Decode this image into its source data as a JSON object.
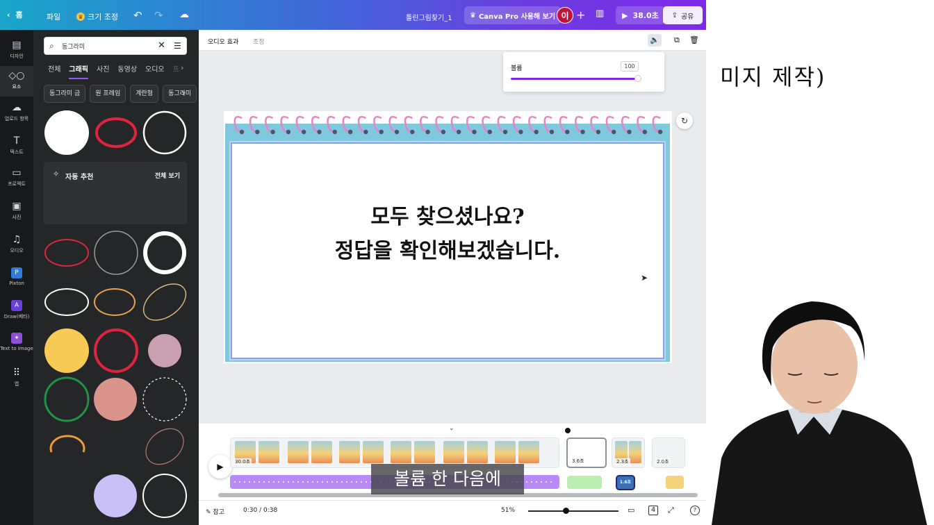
{
  "topbar": {
    "home": "홈",
    "file": "파일",
    "resize": "크기 조정",
    "title": "틀린그림찾기_1",
    "pro": "Canva Pro 사용해 보기",
    "avatar": "이",
    "play_time": "38.0초",
    "share": "공유"
  },
  "rail": [
    {
      "label": "디자인",
      "icon": "layout-icon"
    },
    {
      "label": "요소",
      "icon": "elements-icon"
    },
    {
      "label": "업로드 항목",
      "icon": "upload-cloud-icon"
    },
    {
      "label": "텍스트",
      "icon": "text-icon"
    },
    {
      "label": "프로젝트",
      "icon": "folder-icon"
    },
    {
      "label": "사진",
      "icon": "photo-icon"
    },
    {
      "label": "오디오",
      "icon": "music-icon"
    },
    {
      "label": "Pixton",
      "icon": "pixton-icon"
    },
    {
      "label": "Draw(베타)",
      "icon": "draw-icon"
    },
    {
      "label": "Text to Image",
      "icon": "text-to-image-icon"
    },
    {
      "label": "앱",
      "icon": "apps-grid-icon"
    }
  ],
  "panel": {
    "search_value": "동그라미",
    "tabs": [
      "전체",
      "그래픽",
      "사진",
      "동영상",
      "오디오",
      "프"
    ],
    "active_tab": "그래픽",
    "chips": [
      "동그라미 금",
      "원 프레임",
      "계란형",
      "동그라미"
    ],
    "auto_title": "자동 추천",
    "see_all": "전체 보기"
  },
  "ctxbar": {
    "audio_effect": "오디오 효과",
    "adjust": "조정"
  },
  "volume": {
    "label": "볼륨",
    "value": "100",
    "level": 1.0
  },
  "slide": {
    "line1": "모두 찾으셨나요?",
    "line2": "정답을 확인해보겠습니다."
  },
  "timeline": {
    "clips": [
      {
        "dur": "30.0초"
      },
      {
        "dur": "3.6초"
      },
      {
        "dur": "2.3초"
      },
      {
        "dur": "2.0초"
      }
    ],
    "audio_badge": "1.6초"
  },
  "subtitle": "볼륨 한 다음에",
  "status": {
    "notes": "참고",
    "time": "0:30 / 0:38",
    "zoom": "51%"
  },
  "board": {
    "text": "미지 제작)"
  },
  "colors": {
    "brand_start": "#19a6c9",
    "brand_end": "#7d2ae8",
    "frame": "#7fc8dd",
    "spiral": "#ef7fc4"
  }
}
